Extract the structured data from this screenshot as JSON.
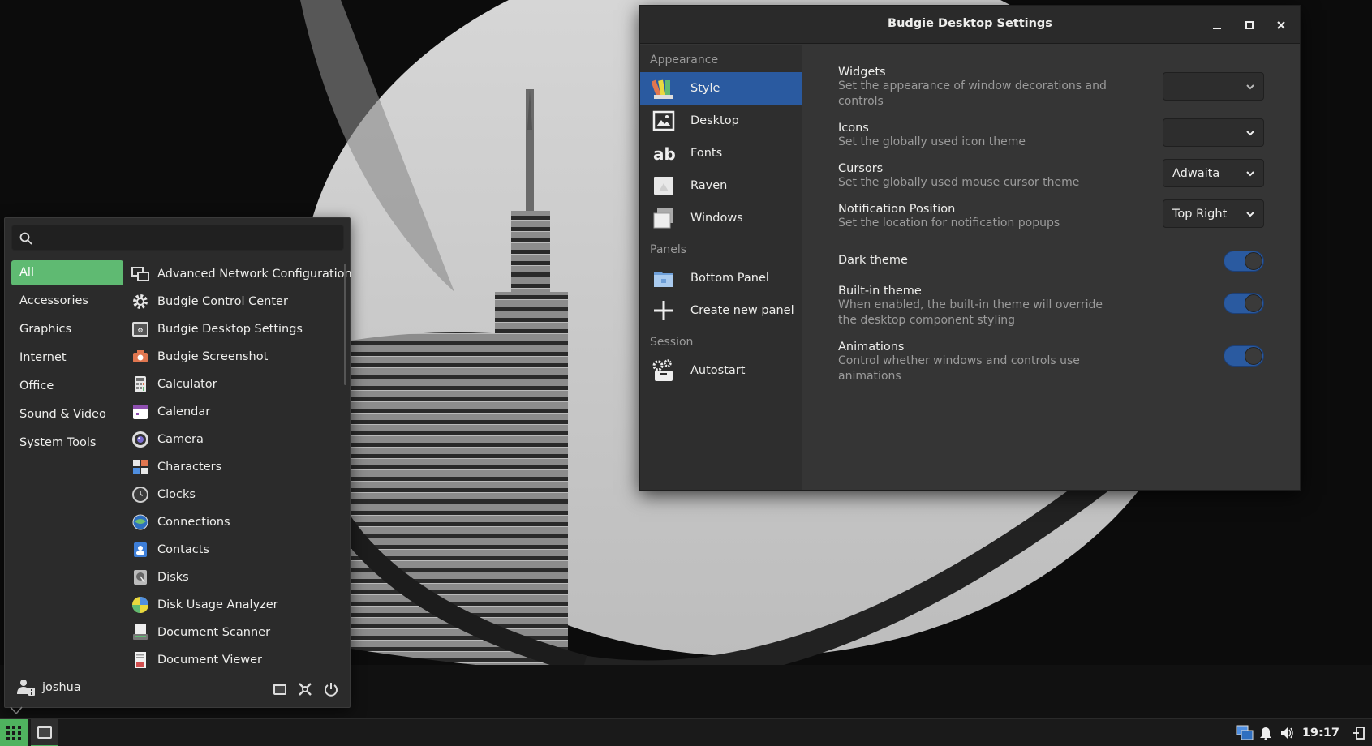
{
  "menu": {
    "search": {
      "placeholder": "",
      "value": ""
    },
    "categories": [
      {
        "label": "All",
        "active": true
      },
      {
        "label": "Accessories"
      },
      {
        "label": "Graphics"
      },
      {
        "label": "Internet"
      },
      {
        "label": "Office"
      },
      {
        "label": "Sound & Video"
      },
      {
        "label": "System Tools"
      }
    ],
    "apps": [
      {
        "label": "Advanced Network Configuration",
        "icon": "network-icon"
      },
      {
        "label": "Budgie Control Center",
        "icon": "gear-icon"
      },
      {
        "label": "Budgie Desktop Settings",
        "icon": "budgie-settings-icon"
      },
      {
        "label": "Budgie Screenshot",
        "icon": "camera-screenshot-icon"
      },
      {
        "label": "Calculator",
        "icon": "calculator-icon"
      },
      {
        "label": "Calendar",
        "icon": "calendar-icon"
      },
      {
        "label": "Camera",
        "icon": "camera-icon"
      },
      {
        "label": "Characters",
        "icon": "characters-icon"
      },
      {
        "label": "Clocks",
        "icon": "clock-icon"
      },
      {
        "label": "Connections",
        "icon": "connections-icon"
      },
      {
        "label": "Contacts",
        "icon": "contacts-icon"
      },
      {
        "label": "Disks",
        "icon": "disks-icon"
      },
      {
        "label": "Disk Usage Analyzer",
        "icon": "disk-usage-icon"
      },
      {
        "label": "Document Scanner",
        "icon": "scanner-icon"
      },
      {
        "label": "Document Viewer",
        "icon": "document-viewer-icon"
      }
    ],
    "user": {
      "name": "joshua"
    }
  },
  "window": {
    "title": "Budgie Desktop Settings",
    "sidebar": {
      "sections": [
        {
          "label": "Appearance",
          "items": [
            {
              "label": "Style",
              "active": true,
              "icon": "style-icon"
            },
            {
              "label": "Desktop",
              "icon": "desktop-icon"
            },
            {
              "label": "Fonts",
              "icon": "fonts-icon"
            },
            {
              "label": "Raven",
              "icon": "raven-icon"
            },
            {
              "label": "Windows",
              "icon": "windows-icon"
            }
          ]
        },
        {
          "label": "Panels",
          "items": [
            {
              "label": "Bottom Panel",
              "icon": "panel-icon"
            },
            {
              "label": "Create new panel",
              "icon": "plus-icon"
            }
          ]
        },
        {
          "label": "Session",
          "items": [
            {
              "label": "Autostart",
              "icon": "autostart-icon"
            }
          ]
        }
      ]
    },
    "settings": [
      {
        "title": "Widgets",
        "desc": "Set the appearance of window decorations and controls",
        "control": "combo",
        "value": ""
      },
      {
        "title": "Icons",
        "desc": "Set the globally used icon theme",
        "control": "combo",
        "value": ""
      },
      {
        "title": "Cursors",
        "desc": "Set the globally used mouse cursor theme",
        "control": "combo",
        "value": "Adwaita"
      },
      {
        "title": "Notification Position",
        "desc": "Set the location for notification popups",
        "control": "combo",
        "value": "Top Right"
      },
      {
        "title": "Dark theme",
        "desc": "",
        "control": "switch",
        "on": true
      },
      {
        "title": "Built-in theme",
        "desc": "When enabled, the built-in theme will override the desktop component styling",
        "control": "switch",
        "on": true
      },
      {
        "title": "Animations",
        "desc": "Control whether windows and controls use animations",
        "control": "switch",
        "on": true
      }
    ]
  },
  "panel": {
    "clock": "19:17"
  },
  "colors": {
    "accent": "#2a5aa0",
    "menu_accent": "#5fba72",
    "panel_button": "#4fb35f"
  }
}
